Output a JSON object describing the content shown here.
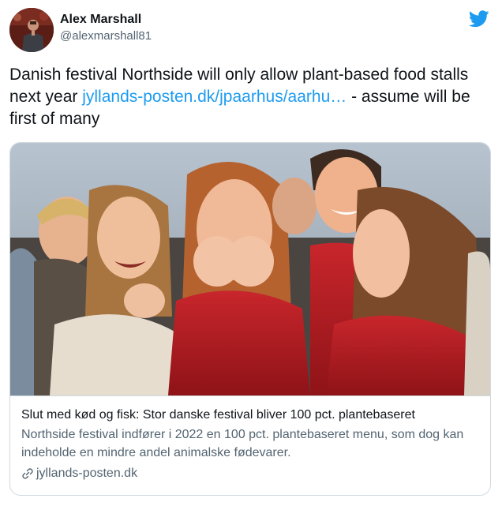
{
  "author": {
    "display_name": "Alex Marshall",
    "handle": "@alexmarshall81",
    "avatar_icon": "avatar-photo"
  },
  "brand": {
    "icon": "twitter-bird-icon",
    "color": "#1d9bf0"
  },
  "tweet": {
    "text_before": "Danish festival Northside will only allow plant-based food stalls next year ",
    "link_text": "jyllands-posten.dk/jpaarhus/aarhu…",
    "text_after": " - assume will be first of many"
  },
  "card": {
    "image_icon": "crowd-photo",
    "title": "Slut med kød og fisk: Stor danske festival bliver 100 pct. plantebaseret",
    "description": "Northside festival indfører i 2022 en 100 pct. plantebaseret menu, som dog kan indeholde en mindre andel animalske fødevarer.",
    "domain": "jyllands-posten.dk",
    "domain_icon": "link-icon"
  }
}
